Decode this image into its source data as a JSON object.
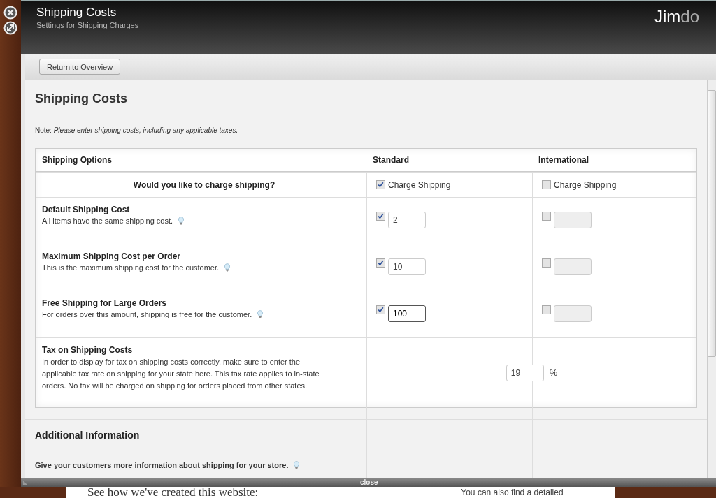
{
  "dialog": {
    "title": "Shipping Costs",
    "subtitle": "Settings for Shipping Charges",
    "logo_main": "Jim",
    "logo_tail": "do"
  },
  "toolbar": {
    "button": "Return to Overview"
  },
  "heading": "Shipping Costs",
  "note": "Note: *Please enter shipping costs, including any applicable taxes.*",
  "table": {
    "columns": [
      "Shipping Options",
      "Standard",
      "International"
    ],
    "rows": [
      {
        "kind": "toggle",
        "title": "Would you like to charge shipping?",
        "standard": {
          "checked": true,
          "label": "Charge Shipping"
        },
        "international": {
          "checked": false,
          "label": "Charge Shipping"
        }
      },
      {
        "kind": "amount",
        "title": "Default Shipping Cost",
        "description": "All items have the same shipping cost.",
        "standard": {
          "checked": true,
          "value": "2",
          "focused": false,
          "disabled": false
        },
        "international": {
          "checked": false,
          "focused": false,
          "disabled": true
        }
      },
      {
        "kind": "amount",
        "title": "Maximum Shipping Cost per Order",
        "description": "This is the maximum shipping cost for the customer.",
        "standard": {
          "checked": true,
          "value": "10",
          "focused": false,
          "disabled": false
        },
        "international": {
          "checked": false,
          "focused": false,
          "disabled": true
        }
      },
      {
        "kind": "amount",
        "title": "Free Shipping for Large Orders",
        "description": "For orders over this amount, shipping is free for the customer.",
        "standard": {
          "checked": true,
          "value": "100",
          "focused": true,
          "disabled": false
        },
        "international": {
          "checked": false,
          "focused": false,
          "disabled": true
        }
      },
      {
        "kind": "tax",
        "title": "Tax on Shipping Costs",
        "description": "In order to display for tax on shipping costs correctly, make sure to enter the applicable tax rate on shipping for your state here. This tax rate applies to in-state orders. No tax will be charged on shipping for orders placed from other states.",
        "value": "19",
        "unit": "%"
      }
    ]
  },
  "additional": {
    "heading": "Additional Information",
    "prompt": "Give your customers more information about shipping for your store."
  },
  "footer": {
    "close": "close"
  },
  "background_page": {
    "heading": "See how we've created this website:",
    "text": "You can also find a detailed"
  }
}
